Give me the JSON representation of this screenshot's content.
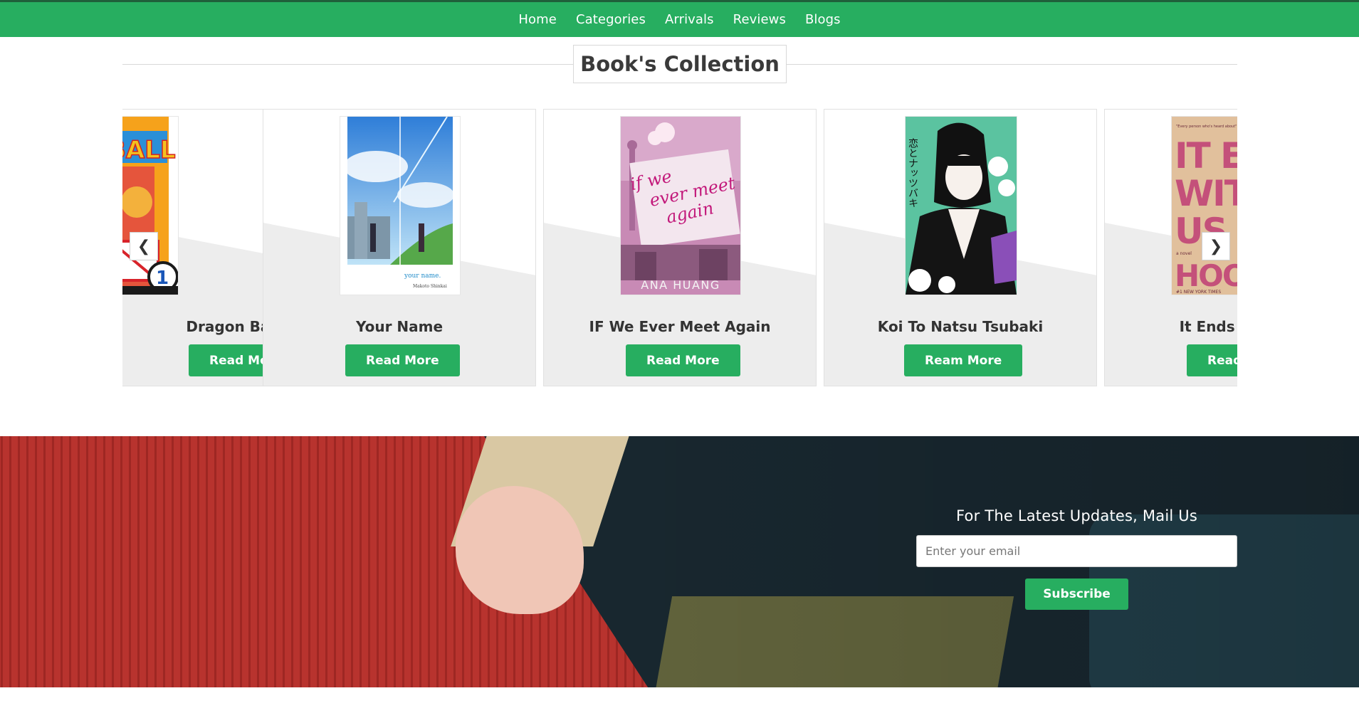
{
  "nav": {
    "links": [
      "Home",
      "Categories",
      "Arrivals",
      "Reviews",
      "Blogs"
    ]
  },
  "collection": {
    "title": "Book's Collection",
    "books": [
      {
        "title": "Dragon Ball Z",
        "button": "Read More",
        "cover_text": "BALL"
      },
      {
        "title": "Your Name",
        "button": "Read More",
        "cover_text": "your name."
      },
      {
        "title": "IF We Ever Meet Again",
        "button": "Read More",
        "cover_text": "if we ever meet again",
        "cover_author": "ANA HUANG"
      },
      {
        "title": "Koi To Natsu Tsubaki",
        "button": "Ream More",
        "cover_text": "恋とナッツバキ"
      },
      {
        "title": "It Ends With Us",
        "button": "Read More",
        "cover_text": "IT ENDS WITH US",
        "cover_author": "HOOVER"
      }
    ]
  },
  "newsletter": {
    "heading": "For The Latest Updates, Mail Us",
    "email_placeholder": "Enter your email",
    "subscribe_label": "Subscribe"
  },
  "colors": {
    "brand_green": "#27ae60",
    "text_dark": "#333333"
  }
}
